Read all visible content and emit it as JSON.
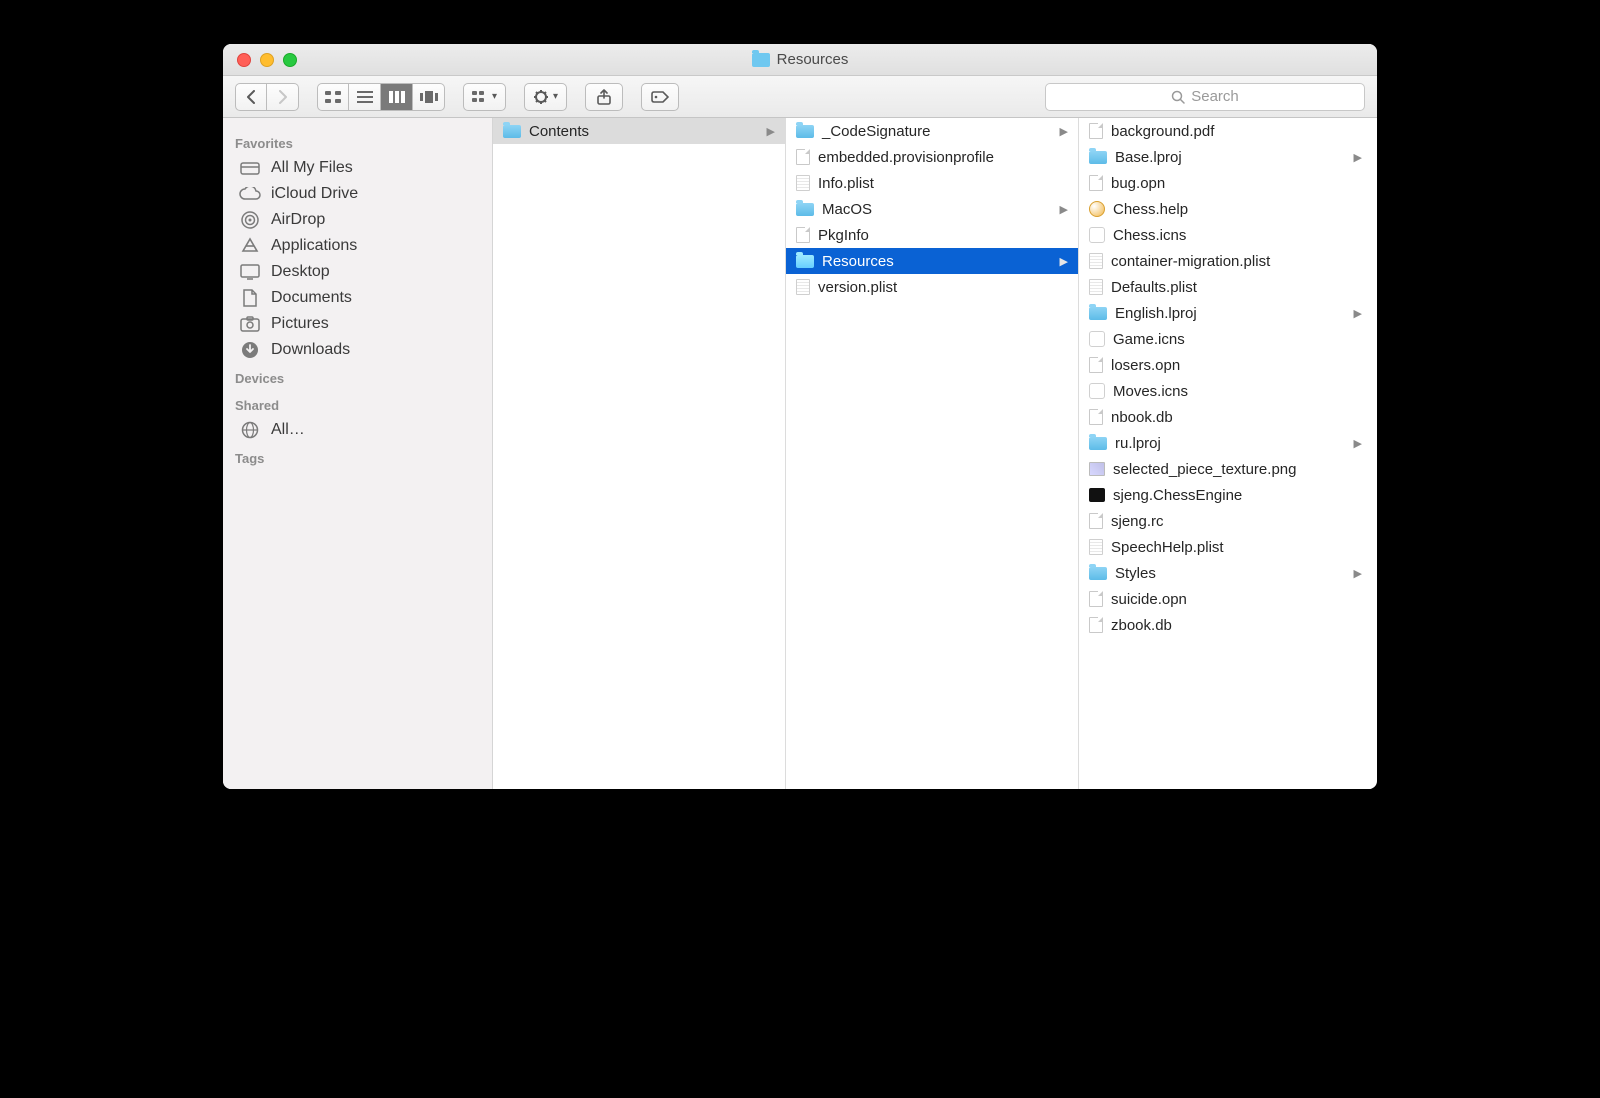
{
  "window_title": "Resources",
  "search_placeholder": "Search",
  "sidebar": {
    "sections": [
      {
        "header": "Favorites",
        "items": [
          {
            "label": "All My Files",
            "icon": "all-files"
          },
          {
            "label": "iCloud Drive",
            "icon": "cloud"
          },
          {
            "label": "AirDrop",
            "icon": "airdrop"
          },
          {
            "label": "Applications",
            "icon": "apps"
          },
          {
            "label": "Desktop",
            "icon": "desktop"
          },
          {
            "label": "Documents",
            "icon": "documents"
          },
          {
            "label": "Pictures",
            "icon": "pictures"
          },
          {
            "label": "Downloads",
            "icon": "downloads"
          }
        ]
      },
      {
        "header": "Devices",
        "items": []
      },
      {
        "header": "Shared",
        "items": [
          {
            "label": "All…",
            "icon": "network"
          }
        ]
      },
      {
        "header": "Tags",
        "items": []
      }
    ]
  },
  "columns": [
    {
      "items": [
        {
          "label": "Contents",
          "type": "folder",
          "has_children": true,
          "selected": "path"
        }
      ]
    },
    {
      "items": [
        {
          "label": "_CodeSignature",
          "type": "folder",
          "has_children": true
        },
        {
          "label": "embedded.provisionprofile",
          "type": "file"
        },
        {
          "label": "Info.plist",
          "type": "plist"
        },
        {
          "label": "MacOS",
          "type": "folder",
          "has_children": true
        },
        {
          "label": "PkgInfo",
          "type": "file"
        },
        {
          "label": "Resources",
          "type": "folder",
          "has_children": true,
          "selected": "active"
        },
        {
          "label": "version.plist",
          "type": "plist"
        }
      ]
    },
    {
      "items": [
        {
          "label": "background.pdf",
          "type": "file"
        },
        {
          "label": "Base.lproj",
          "type": "folder",
          "has_children": true
        },
        {
          "label": "bug.opn",
          "type": "file"
        },
        {
          "label": "Chess.help",
          "type": "help"
        },
        {
          "label": "Chess.icns",
          "type": "icns"
        },
        {
          "label": "container-migration.plist",
          "type": "plist"
        },
        {
          "label": "Defaults.plist",
          "type": "plist"
        },
        {
          "label": "English.lproj",
          "type": "folder",
          "has_children": true
        },
        {
          "label": "Game.icns",
          "type": "icns"
        },
        {
          "label": "losers.opn",
          "type": "file"
        },
        {
          "label": "Moves.icns",
          "type": "icns"
        },
        {
          "label": "nbook.db",
          "type": "file"
        },
        {
          "label": "ru.lproj",
          "type": "folder",
          "has_children": true
        },
        {
          "label": "selected_piece_texture.png",
          "type": "png"
        },
        {
          "label": "sjeng.ChessEngine",
          "type": "exec"
        },
        {
          "label": "sjeng.rc",
          "type": "file"
        },
        {
          "label": "SpeechHelp.plist",
          "type": "plist"
        },
        {
          "label": "Styles",
          "type": "folder",
          "has_children": true
        },
        {
          "label": "suicide.opn",
          "type": "file"
        },
        {
          "label": "zbook.db",
          "type": "file"
        }
      ]
    }
  ]
}
